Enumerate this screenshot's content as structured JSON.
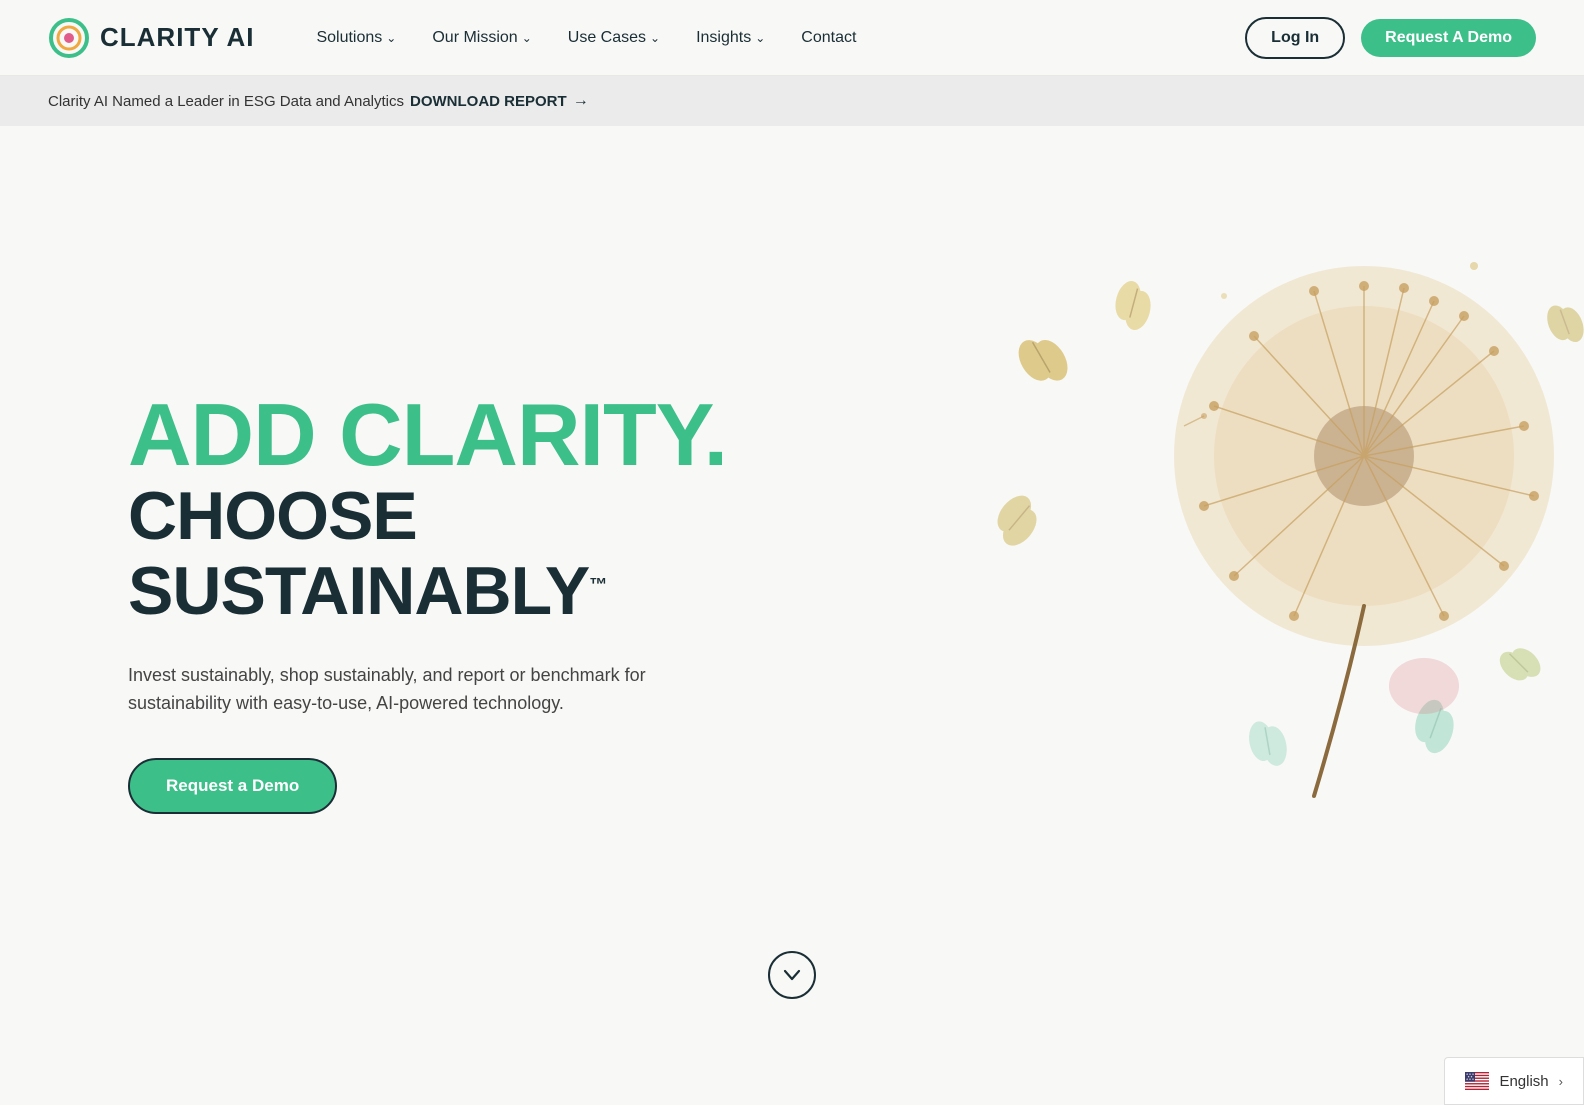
{
  "navbar": {
    "logo_text": "CLARITY AI",
    "nav_items": [
      {
        "label": "Solutions",
        "has_dropdown": true
      },
      {
        "label": "Our Mission",
        "has_dropdown": true
      },
      {
        "label": "Use Cases",
        "has_dropdown": true
      },
      {
        "label": "Insights",
        "has_dropdown": true
      },
      {
        "label": "Contact",
        "has_dropdown": false
      }
    ],
    "login_label": "Log In",
    "demo_label": "Request A Demo"
  },
  "announcement": {
    "text": "Clarity AI Named a Leader in ESG Data and Analytics",
    "download_text": "DOWNLOAD REPORT",
    "arrow": "→"
  },
  "hero": {
    "title_line1": "ADD CLARITY.",
    "title_line2": "CHOOSE SUSTAINABLY",
    "trademark": "™",
    "description": "Invest sustainably, shop sustainably, and report or benchmark for sustainability with easy-to-use, AI-powered technology.",
    "cta_label": "Request a Demo"
  },
  "scroll_down": {
    "label": "scroll down"
  },
  "language": {
    "label": "English"
  },
  "colors": {
    "brand_green": "#3dbf8a",
    "brand_dark": "#1a2e35",
    "bg": "#f8f8f6"
  }
}
